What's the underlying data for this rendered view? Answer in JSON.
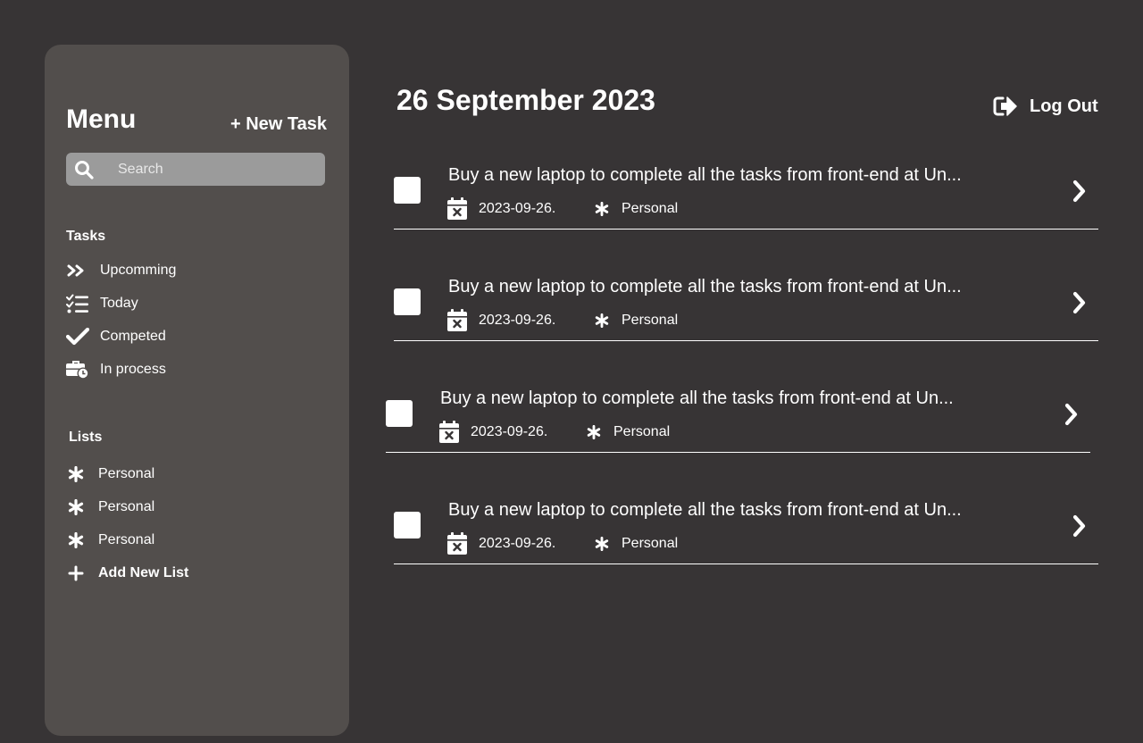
{
  "sidebar": {
    "title": "Menu",
    "new_task_label": "+ New Task",
    "search_placeholder": "Search",
    "tasks_heading": "Tasks",
    "task_items": [
      {
        "label": "Upcomming",
        "icon": "double-chevron-right-icon"
      },
      {
        "label": "Today",
        "icon": "checklist-icon"
      },
      {
        "label": "Competed",
        "icon": "check-icon"
      },
      {
        "label": "In process",
        "icon": "briefcase-clock-icon"
      }
    ],
    "lists_heading": "Lists",
    "list_items": [
      {
        "label": "Personal",
        "icon": "asterisk-icon"
      },
      {
        "label": "Personal",
        "icon": "asterisk-icon"
      },
      {
        "label": "Personal",
        "icon": "asterisk-icon"
      }
    ],
    "add_list_label": "Add New List"
  },
  "header": {
    "date": "26 September 2023",
    "logout_label": "Log Out"
  },
  "tasks": [
    {
      "title": "Buy a new laptop to complete all the tasks from front-end at Un...",
      "date": "2023-09-26.",
      "list": "Personal"
    },
    {
      "title": "Buy a new laptop to complete all the tasks from front-end at Un...",
      "date": "2023-09-26.",
      "list": "Personal"
    },
    {
      "title": "Buy a new laptop to complete all the tasks from front-end at Un...",
      "date": "2023-09-26.",
      "list": "Personal"
    },
    {
      "title": "Buy a new laptop to complete all the tasks from front-end at Un...",
      "date": "2023-09-26.",
      "list": "Personal"
    }
  ],
  "colors": {
    "background": "#373435",
    "sidebar": "#524e4c",
    "search": "#9b9b9b",
    "text": "#ffffff"
  }
}
